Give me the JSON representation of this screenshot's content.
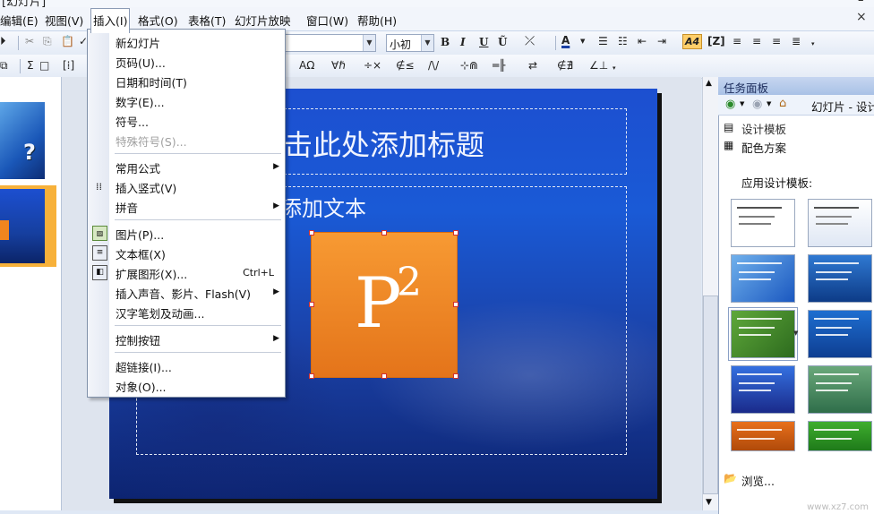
{
  "window": {
    "title_fragment": "[幻灯片]",
    "min_icon": "–"
  },
  "menubar": {
    "items": [
      {
        "label": "编辑(E)"
      },
      {
        "label": "视图(V)"
      },
      {
        "label": "插入(I)"
      },
      {
        "label": "格式(O)"
      },
      {
        "label": "表格(T)"
      },
      {
        "label": "幻灯片放映"
      },
      {
        "label": "窗口(W)"
      },
      {
        "label": "帮助(H)"
      }
    ],
    "close_icon": "×"
  },
  "toolbar1": {
    "font_size": "小初",
    "bold": "B",
    "italic": "I",
    "underline": "U",
    "font_change": "Ũ",
    "font_color": "A",
    "highlight": "A4",
    "bracket": "[Z]"
  },
  "toolbar2": {
    "sum": "Σ",
    "formula_a": "AΩ",
    "formula_b": "∀ℏ",
    "formula_c": "÷×",
    "formula_d": "∉≤",
    "formula_e": "/\\/",
    "formula_f": "⊹⋒",
    "formula_g": "═╟",
    "formula_h": "⇄",
    "formula_i": "∉∄",
    "formula_j": "∠⊥"
  },
  "insert_menu": {
    "items": [
      {
        "label": "新幻灯片"
      },
      {
        "label": "页码(U)..."
      },
      {
        "label": "日期和时间(T)"
      },
      {
        "label": "数字(E)..."
      },
      {
        "label": "符号..."
      },
      {
        "label": "特殊符号(S)..."
      },
      {
        "label": "常用公式"
      },
      {
        "label": "插入竖式(V)"
      },
      {
        "label": "拼音"
      },
      {
        "label": "图片(P)..."
      },
      {
        "label": "文本框(X)"
      },
      {
        "label": "扩展图形(X)...",
        "shortcut": "Ctrl+L"
      },
      {
        "label": "插入声音、影片、Flash(V)"
      },
      {
        "label": "汉字笔划及动画..."
      },
      {
        "label": "控制按钮"
      },
      {
        "label": "超链接(I)..."
      },
      {
        "label": "对象(O)..."
      }
    ],
    "submenu_arrow": "▶"
  },
  "slide": {
    "title_text": "击此处添加标题",
    "body_text": "添加文本",
    "image_main": "P",
    "image_sup": "2"
  },
  "task_pane": {
    "header": "任务面板",
    "nav_title": "幻灯片 - 设计",
    "link_design": "设计模板",
    "link_color": "配色方案",
    "apply_label": "应用设计模板:",
    "browse": "浏览..."
  },
  "thumbnails": {
    "q_mark": "?"
  },
  "watermark": "www.xz7.com",
  "colors": {
    "menu_bg": "#ffffff",
    "selected_thumb": "#f7b13a",
    "slide_blue": "#1c4fd0",
    "p2_orange": "#f0851f"
  }
}
